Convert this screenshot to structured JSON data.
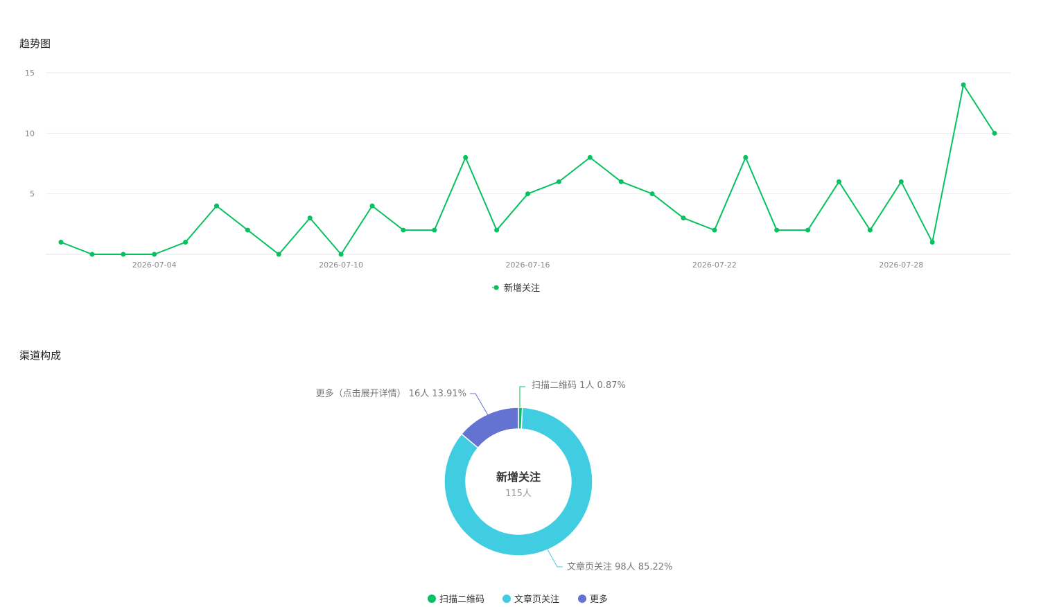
{
  "sections": {
    "trend_title": "趋势图",
    "channel_title": "渠道构成"
  },
  "colors": {
    "line": "#07c160",
    "scan_qr": "#07c160",
    "article": "#40cce1",
    "more": "#6472d1",
    "grid": "#eeeeee",
    "axis_text": "#888888"
  },
  "chart_data": [
    {
      "type": "line",
      "title": "",
      "xlabel": "",
      "ylabel": "",
      "ylim": [
        0,
        15
      ],
      "yticks": [
        5,
        10,
        15
      ],
      "grid": true,
      "legend_position": "bottom",
      "x": [
        "2026-07-01",
        "2026-07-02",
        "2026-07-03",
        "2026-07-04",
        "2026-07-05",
        "2026-07-06",
        "2026-07-07",
        "2026-07-08",
        "2026-07-09",
        "2026-07-10",
        "2026-07-11",
        "2026-07-12",
        "2026-07-13",
        "2026-07-14",
        "2026-07-15",
        "2026-07-16",
        "2026-07-17",
        "2026-07-18",
        "2026-07-19",
        "2026-07-20",
        "2026-07-21",
        "2026-07-22",
        "2026-07-23",
        "2026-07-24",
        "2026-07-25",
        "2026-07-26",
        "2026-07-27",
        "2026-07-28",
        "2026-07-29",
        "2026-07-30",
        "2026-07-31"
      ],
      "x_tick_labels": [
        "2026-07-04",
        "2026-07-10",
        "2026-07-16",
        "2026-07-22",
        "2026-07-28"
      ],
      "series": [
        {
          "name": "新增关注",
          "values": [
            1,
            0,
            0,
            0,
            1,
            4,
            2,
            0,
            3,
            0,
            4,
            2,
            2,
            8,
            2,
            5,
            6,
            8,
            6,
            5,
            3,
            2,
            8,
            2,
            2,
            6,
            2,
            6,
            1,
            14,
            10
          ]
        }
      ]
    },
    {
      "type": "pie",
      "title": "新增关注",
      "subtitle": "115人",
      "legend_position": "bottom",
      "slices": [
        {
          "name": "扫描二维码",
          "value": 1,
          "label": "扫描二维码 1人 0.87%"
        },
        {
          "name": "文章页关注",
          "value": 98,
          "label": "文章页关注 98人 85.22%"
        },
        {
          "name": "更多",
          "value": 16,
          "label": "更多（点击展开详情） 16人 13.91%"
        }
      ]
    }
  ]
}
